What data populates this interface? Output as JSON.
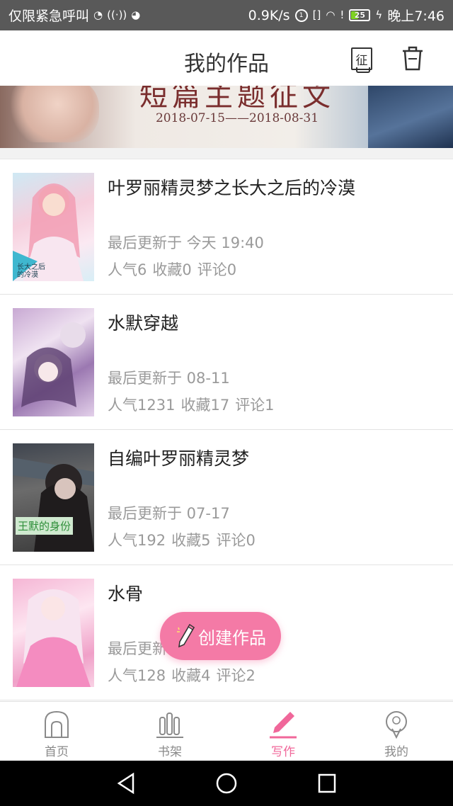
{
  "status_bar": {
    "carrier": "仅限紧急呼叫",
    "speed": "0.9K/s",
    "battery": "25",
    "time": "晚上7:46"
  },
  "header": {
    "title": "我的作品",
    "contest_label": "征"
  },
  "banner": {
    "title_fragment": "短篇主题征文",
    "date_range": "2018-07-15——2018-08-31"
  },
  "works": [
    {
      "title": "叶罗丽精灵梦之长大之后的冷漠",
      "updated": "最后更新于 今天 19:40",
      "popularity": "人气6",
      "favorites": "收藏0",
      "comments": "评论0",
      "cover_text": "长大之后的冷漠",
      "cover_colors": [
        "#f7d6e2",
        "#c9e7f2",
        "#fbeff5"
      ]
    },
    {
      "title": "水默穿越",
      "updated": "最后更新于 08-11",
      "popularity": "人气1231",
      "favorites": "收藏17",
      "comments": "评论1",
      "cover_text": "",
      "cover_colors": [
        "#b794c2",
        "#e6d4ea",
        "#6e4f86"
      ]
    },
    {
      "title": "自编叶罗丽精灵梦",
      "updated": "最后更新于 07-17",
      "popularity": "人气192",
      "favorites": "收藏5",
      "comments": "评论0",
      "cover_text": "王默的身份",
      "cover_colors": [
        "#4a4a4a",
        "#7a7a7a",
        "#2c2c2c"
      ]
    },
    {
      "title": "水骨",
      "updated": "最后更新于 07-",
      "popularity": "人气128",
      "favorites": "收藏4",
      "comments": "评论2",
      "cover_text": "",
      "cover_colors": [
        "#f3a9cf",
        "#fde3f0",
        "#e57fb4"
      ]
    }
  ],
  "fab": {
    "label": "创建作品"
  },
  "tabs": [
    {
      "label": "首页",
      "icon": "home-icon"
    },
    {
      "label": "书架",
      "icon": "bookshelf-icon"
    },
    {
      "label": "写作",
      "icon": "pen-icon",
      "active": true
    },
    {
      "label": "我的",
      "icon": "profile-icon"
    }
  ],
  "colors": {
    "accent": "#f0679a",
    "fab": "#f47aa6",
    "status_bar": "#595959",
    "muted_text": "#9a9a9a"
  }
}
